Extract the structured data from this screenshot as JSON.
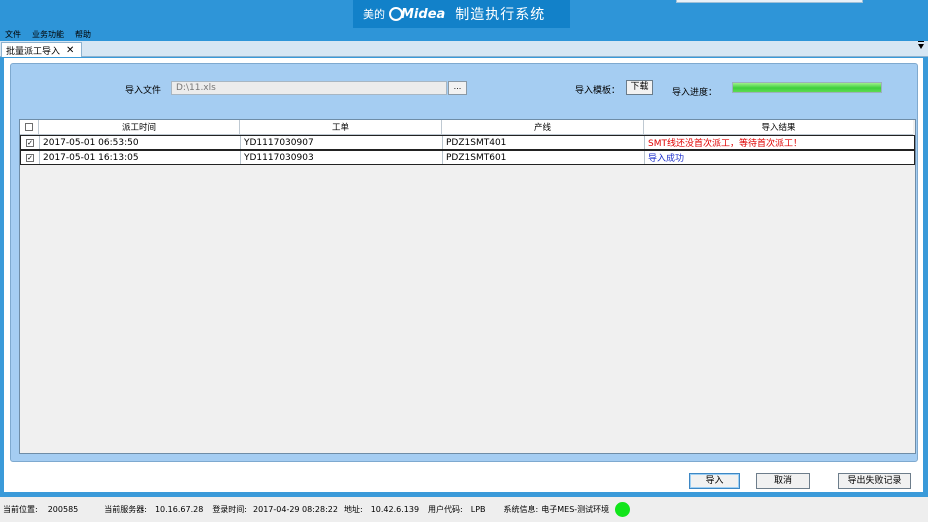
{
  "header": {
    "brand_cn": "美的",
    "brand_logo": "Midea",
    "system_title": "制造执行系统"
  },
  "menu": [
    "文件",
    "业务功能",
    "帮助"
  ],
  "tab": {
    "label": "批量派工导入",
    "close": "✕"
  },
  "form": {
    "file_label": "导入文件",
    "file_value": "D:\\11.xls",
    "browse_label": "...",
    "template_label": "导入模板：",
    "download_label": "下载",
    "progress_label": "导入进度：",
    "progress_percent": 100
  },
  "grid": {
    "columns": [
      "派工时间",
      "工单",
      "产线",
      "导入结果"
    ],
    "rows": [
      {
        "checked": true,
        "time": "2017-05-01 06:53:50",
        "order": "YD1117030907",
        "line": "PDZ1SMT401",
        "result": "SMT线还没首次派工，等待首次派工！",
        "result_status": "error"
      },
      {
        "checked": true,
        "time": "2017-05-01 16:13:05",
        "order": "YD1117030903",
        "line": "PDZ1SMT601",
        "result": "导入成功",
        "result_status": "success"
      }
    ]
  },
  "buttons": {
    "import": "导入",
    "cancel": "取消",
    "export_fail": "导出失败记录"
  },
  "status": {
    "position_label": "当前位置:",
    "position_value": "200585",
    "server_label": "当前服务器:",
    "server_value": "10.16.67.28",
    "login_label": "登录时间:",
    "login_value": "2017-04-29 08:28:22",
    "address_label": "地址:",
    "address_value": "10.42.6.139",
    "user_label": "用户代码:",
    "user_value": "LPB",
    "sysinfo_label": "系统信息:",
    "sysinfo_value": "电子MES-测试环境"
  },
  "colors": {
    "accent": "#2e95d8",
    "panel": "#a5cdf2",
    "error": "#e00000",
    "success": "#1d2fcc",
    "online": "#11e51a"
  }
}
